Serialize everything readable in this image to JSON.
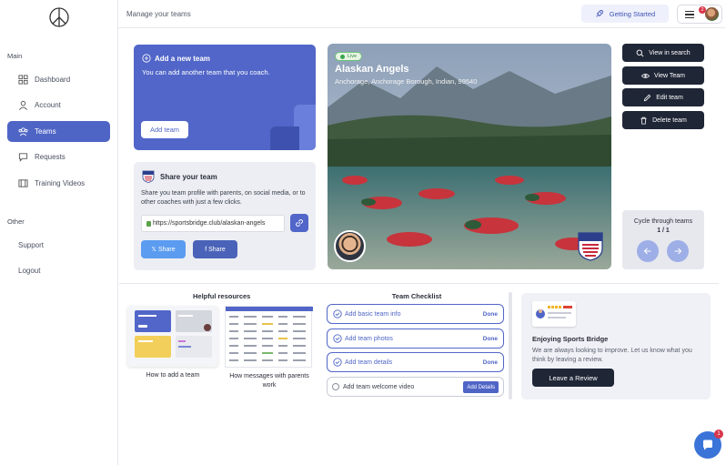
{
  "sidebar": {
    "section_main": "Main",
    "items": [
      {
        "label": "Dashboard",
        "icon": "grid-icon"
      },
      {
        "label": "Account",
        "icon": "user-icon"
      },
      {
        "label": "Teams",
        "icon": "team-icon",
        "active": true
      },
      {
        "label": "Requests",
        "icon": "chat-icon"
      },
      {
        "label": "Training Videos",
        "icon": "film-icon"
      }
    ],
    "section_other": "Other",
    "support": "Support",
    "logout": "Logout"
  },
  "header": {
    "title": "Manage your teams",
    "getting_started": "Getting Started",
    "notification_count": "2"
  },
  "add_team": {
    "title": "Add a new team",
    "subtitle": "You can add another team that you coach.",
    "button": "Add team"
  },
  "share": {
    "title": "Share your team",
    "description": "Share you team profile with parents, on social media, or to other coaches with just a few clicks.",
    "url": "https://sportsbridge.club/alaskan-angels",
    "x_share": "𝕏 Share",
    "fb_share": "f  Share"
  },
  "team": {
    "status": "Live",
    "name": "Alaskan Angels",
    "location": "Anchorage, Anchorage Borough, Indian, 99540"
  },
  "actions": {
    "view_search": "View in search",
    "view_team": "View Team",
    "edit_team": "Edit team",
    "delete_team": "Delete team"
  },
  "cycle": {
    "title": "Cycle through teams",
    "count": "1 / 1"
  },
  "resources": {
    "title": "Helpful resources",
    "items": [
      {
        "caption": "How to add a team"
      },
      {
        "caption": "How messages with parents work"
      }
    ]
  },
  "checklist": {
    "title": "Team Checklist",
    "items": [
      {
        "label": "Add basic team info",
        "status": "Done"
      },
      {
        "label": "Add team photos",
        "status": "Done"
      },
      {
        "label": "Add team details",
        "status": "Done"
      },
      {
        "label": "Add team welcome video",
        "action": "Add Details"
      }
    ]
  },
  "review": {
    "title": "Enjoying Sports Bridge",
    "text": "We are always looking to improve. Let us know what you think by leaving a review.",
    "button": "Leave a Review"
  },
  "chat": {
    "badge": "1"
  },
  "colors": {
    "accent": "#4f65c6",
    "dark": "#1f2636",
    "success": "#3aa64a",
    "alert": "#d9364a"
  }
}
